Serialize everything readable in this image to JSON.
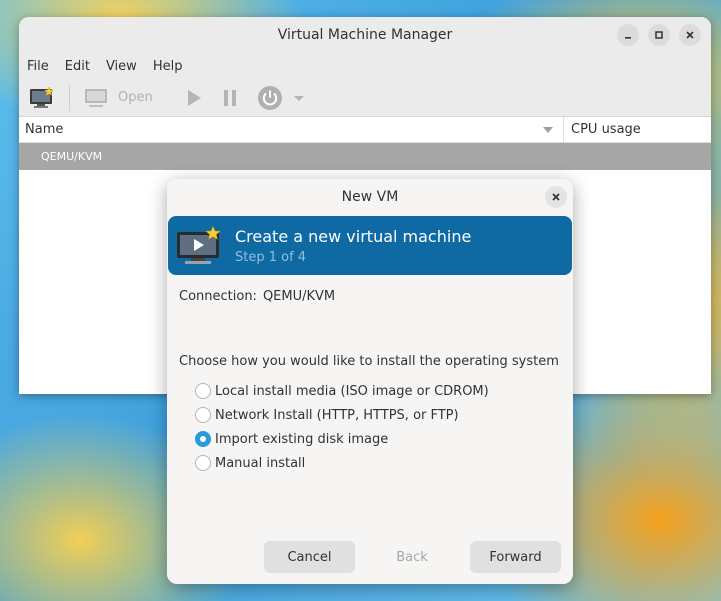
{
  "main_window": {
    "title": "Virtual Machine Manager",
    "menu": [
      "File",
      "Edit",
      "View",
      "Help"
    ],
    "toolbar": {
      "open_label": "Open"
    },
    "columns": {
      "name": "Name",
      "cpu": "CPU usage"
    },
    "rows": [
      {
        "name": "QEMU/KVM"
      }
    ]
  },
  "dialog": {
    "title": "New VM",
    "banner": {
      "title": "Create a new virtual machine",
      "step": "Step 1 of 4"
    },
    "connection_label": "Connection:",
    "connection_value": "QEMU/KVM",
    "prompt": "Choose how you would like to install the operating system",
    "options": [
      {
        "label": "Local install media (ISO image or CDROM)",
        "checked": false
      },
      {
        "label": "Network Install (HTTP, HTTPS, or FTP)",
        "checked": false
      },
      {
        "label": "Import existing disk image",
        "checked": true
      },
      {
        "label": "Manual install",
        "checked": false
      }
    ],
    "buttons": {
      "cancel": "Cancel",
      "back": "Back",
      "forward": "Forward"
    }
  },
  "colors": {
    "banner": "#0f6aa4",
    "radio_checked": "#2a9bd8",
    "selected_row": "#a6a6a6"
  }
}
